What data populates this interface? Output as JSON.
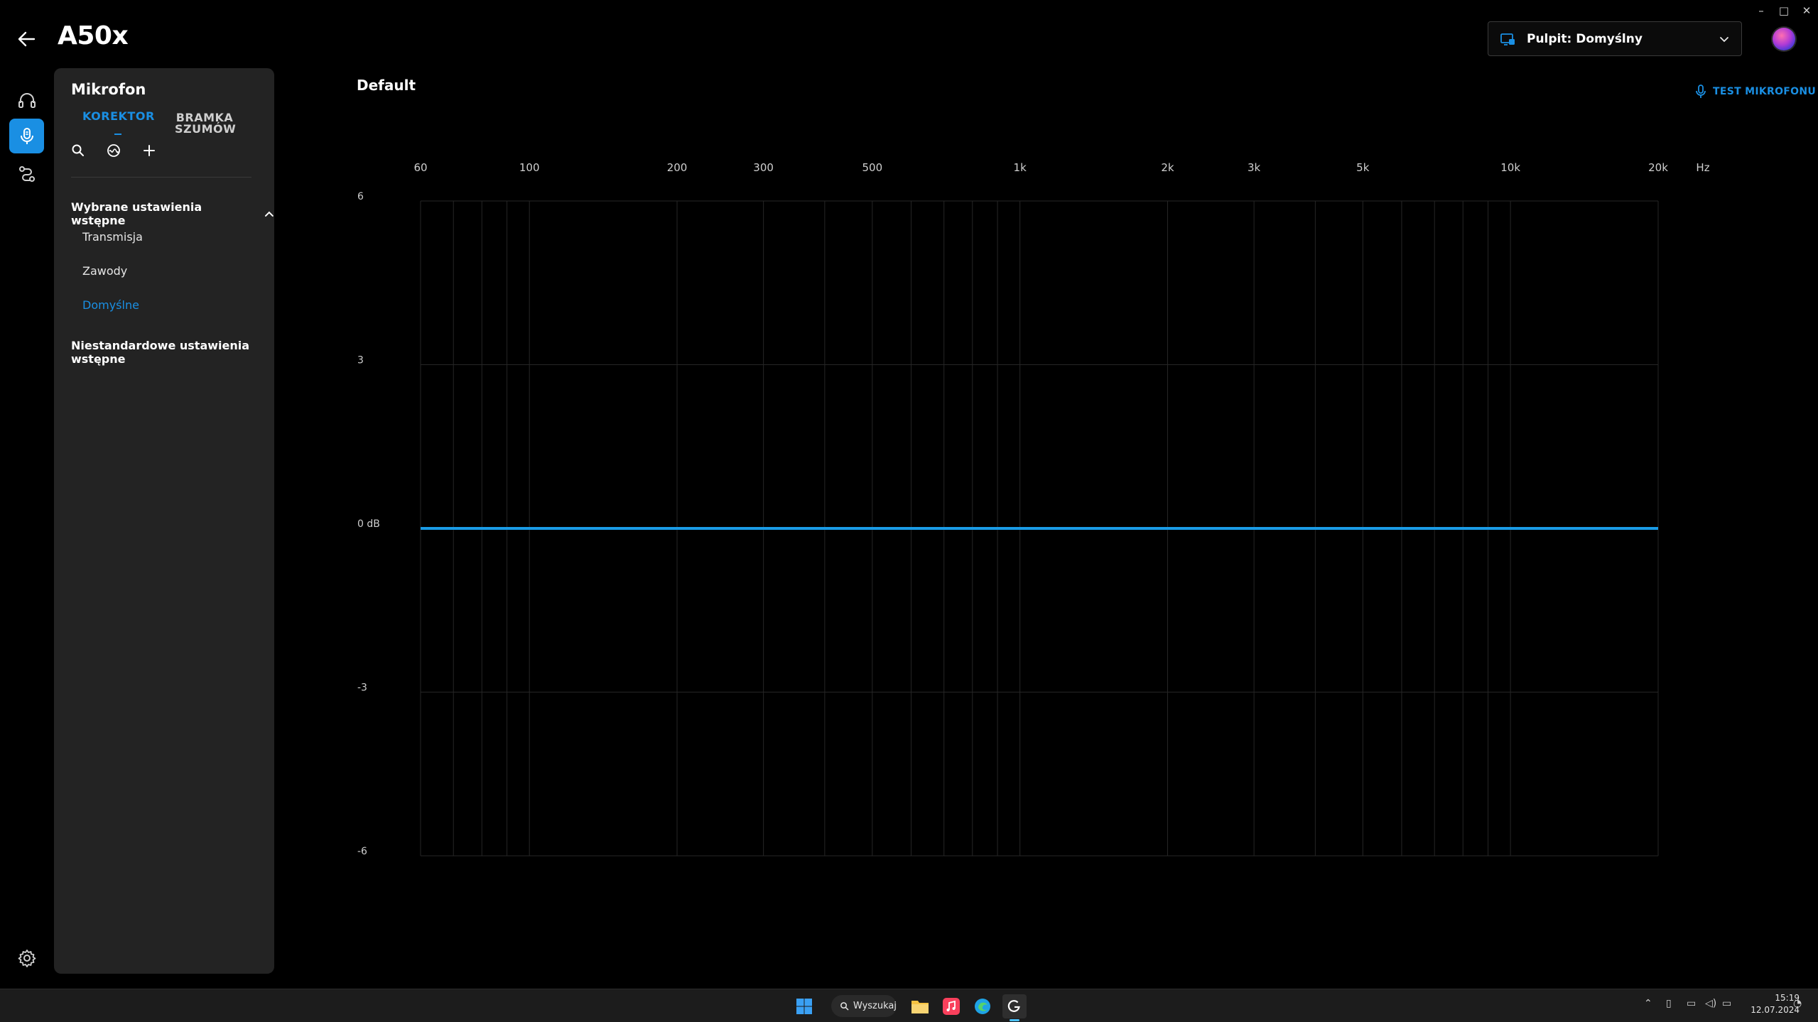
{
  "window": {
    "controls": {
      "minimize": "–",
      "maximize": "□",
      "close": "✕"
    }
  },
  "header": {
    "app_title": "A50x",
    "profile_label": "Pulpit: Domyślny"
  },
  "rail": {
    "items": [
      "headphones-icon",
      "microphone-icon",
      "routing-icon"
    ],
    "active_index": 1
  },
  "panel": {
    "title": "Mikrofon",
    "tabs": [
      {
        "label": "KOREKTOR",
        "active": true
      },
      {
        "label": "BRAMKA SZUMÓW",
        "active": false
      }
    ],
    "tools": [
      "search-icon",
      "sound-wave-icon",
      "add-icon"
    ],
    "selected_section": "Wybrane ustawienia wstępne",
    "presets": [
      {
        "label": "Transmisja",
        "selected": false
      },
      {
        "label": "Zawody",
        "selected": false
      },
      {
        "label": "Domyślne",
        "selected": true
      }
    ],
    "custom_section": "Niestandardowe ustawienia wstępne"
  },
  "main": {
    "eq_title": "Default",
    "test_mic_label": "TEST MIKROFONU"
  },
  "chart_data": {
    "type": "line",
    "title": "",
    "xlabel": "Hz",
    "ylabel": "",
    "x_scale": "log",
    "x_ticks": [
      {
        "value": 60,
        "label": "60"
      },
      {
        "value": 100,
        "label": "100"
      },
      {
        "value": 200,
        "label": "200"
      },
      {
        "value": 300,
        "label": "300"
      },
      {
        "value": 500,
        "label": "500"
      },
      {
        "value": 1000,
        "label": "1k"
      },
      {
        "value": 2000,
        "label": "2k"
      },
      {
        "value": 3000,
        "label": "3k"
      },
      {
        "value": 5000,
        "label": "5k"
      },
      {
        "value": 10000,
        "label": "10k"
      },
      {
        "value": 20000,
        "label": "20k"
      }
    ],
    "x_unit_label": "Hz",
    "y_ticks": [
      {
        "value": 6,
        "label": "6"
      },
      {
        "value": 3,
        "label": "3"
      },
      {
        "value": 0,
        "label": "0 dB"
      },
      {
        "value": -3,
        "label": "-3"
      },
      {
        "value": -6,
        "label": "-6"
      }
    ],
    "xlim": [
      60,
      20000
    ],
    "ylim": [
      -6,
      6
    ],
    "grid": true,
    "series": [
      {
        "x": [
          60,
          20000
        ],
        "values": [
          0,
          0
        ],
        "color": "#1a9be6"
      }
    ]
  },
  "taskbar": {
    "search_label": "Wyszukaj",
    "time": "15:19",
    "date": "12.07.2024"
  },
  "colors": {
    "accent": "#1a8fe3",
    "panel_bg": "#232323",
    "curve": "#1a9be6"
  }
}
